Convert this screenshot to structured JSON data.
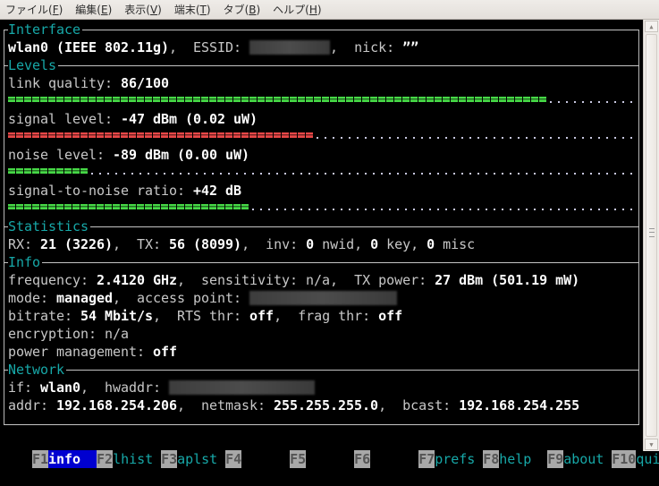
{
  "menubar": {
    "items": [
      {
        "label": "ファイル(",
        "key": "F",
        "end": ")"
      },
      {
        "label": "編集(",
        "key": "E",
        "end": ")"
      },
      {
        "label": "表示(",
        "key": "V",
        "end": ")"
      },
      {
        "label": "端末(",
        "key": "T",
        "end": ")"
      },
      {
        "label": "タブ(",
        "key": "B",
        "end": ")"
      },
      {
        "label": "ヘルプ(",
        "key": "H",
        "end": ")"
      }
    ]
  },
  "sections": {
    "interface": "Interface",
    "levels": "Levels",
    "statistics": "Statistics",
    "info": "Info",
    "network": "Network"
  },
  "interface": {
    "name": "wlan0 (IEEE 802.11g)",
    "sep1": ",  ",
    "essid_label": "ESSID: ",
    "sep2": ",  ",
    "nick_label": "nick: ",
    "nick_value": "””"
  },
  "levels": {
    "link_quality": {
      "label": "link quality: ",
      "value": "86/100",
      "fraction": 0.86,
      "color": "#46d846"
    },
    "signal_level": {
      "label": "signal level: ",
      "value": "-47 dBm (0.02 uW)",
      "fraction": 0.49,
      "color": "#e84848"
    },
    "noise_level": {
      "label": "noise level: ",
      "value": "-89 dBm (0.00 uW)",
      "fraction": 0.13,
      "color": "#46d846"
    },
    "snr": {
      "label": "signal-to-noise ratio: ",
      "value": "+42 dB",
      "fraction": 0.38,
      "color": "#46d846"
    }
  },
  "statistics": {
    "rx_label": "RX: ",
    "rx_value": "21 (3226)",
    "tx_label": ",  TX: ",
    "tx_value": "56 (8099)",
    "inv_label": ",  inv: ",
    "nwid_value": "0",
    "nwid_label": " nwid, ",
    "key_value": "0",
    "key_label": " key, ",
    "misc_value": "0",
    "misc_label": " misc"
  },
  "info": {
    "frequency_label": "frequency: ",
    "frequency_value": "2.4120 GHz",
    "sensitivity_label": ",  sensitivity: n/a,  ",
    "txpower_label": "TX power: ",
    "txpower_value": "27 dBm (501.19 mW)",
    "mode_label": "mode: ",
    "mode_value": "managed",
    "ap_label": ",  access point: ",
    "bitrate_label": "bitrate: ",
    "bitrate_value": "54 Mbit/s",
    "rts_label": ",  RTS thr: ",
    "rts_value": "off",
    "frag_label": ",  frag thr: ",
    "frag_value": "off",
    "encryption": "encryption: n/a",
    "power_label": "power management: ",
    "power_value": "off"
  },
  "network": {
    "if_label": "if: ",
    "if_value": "wlan0",
    "hwaddr_label": ",  hwaddr: ",
    "addr_label": "addr: ",
    "addr_value": "192.168.254.206",
    "netmask_label": ",  netmask: ",
    "netmask_value": "255.255.255.0",
    "bcast_label": ",  bcast: ",
    "bcast_value": "192.168.254.255"
  },
  "fkeys": [
    {
      "key": "F1",
      "label": "info  ",
      "active": true
    },
    {
      "key": "F2",
      "label": "lhist ",
      "active": false
    },
    {
      "key": "F3",
      "label": "aplst ",
      "active": false
    },
    {
      "key": "F4",
      "label": "      ",
      "active": false
    },
    {
      "key": "F5",
      "label": "      ",
      "active": false
    },
    {
      "key": "F6",
      "label": "      ",
      "active": false
    },
    {
      "key": "F7",
      "label": "prefs ",
      "active": false
    },
    {
      "key": "F8",
      "label": "help  ",
      "active": false
    },
    {
      "key": "F9",
      "label": "about ",
      "active": false
    },
    {
      "key": "F10",
      "label": "quit",
      "active": false
    }
  ]
}
